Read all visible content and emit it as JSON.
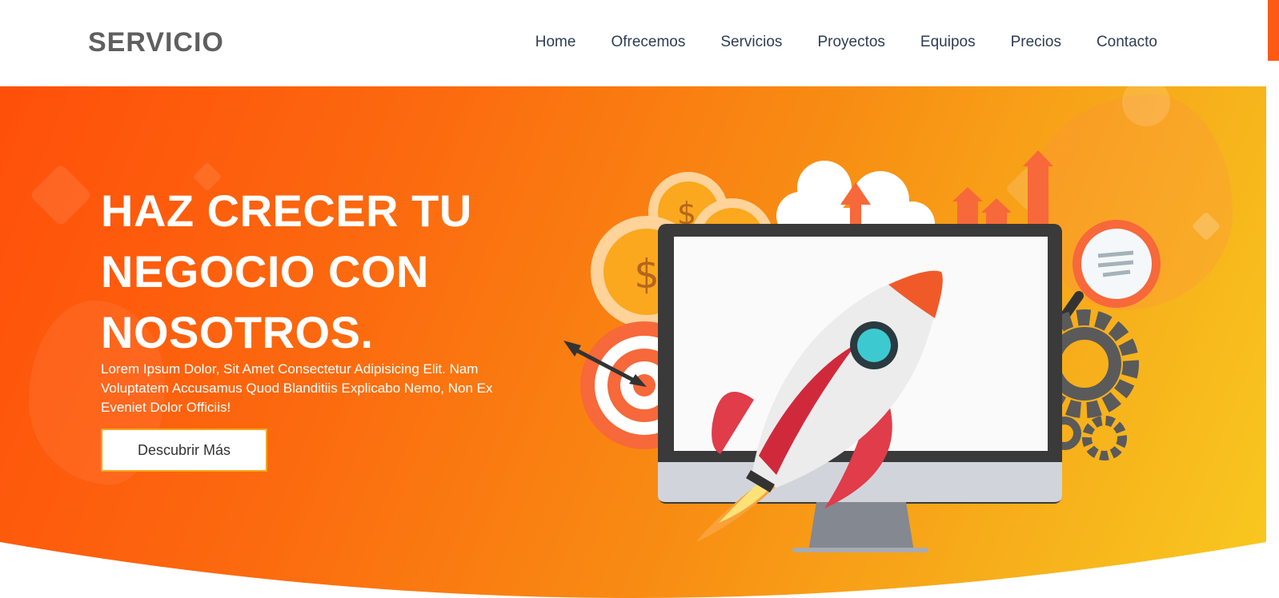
{
  "header": {
    "logo": "SERVICIO",
    "nav": [
      "Home",
      "Ofrecemos",
      "Servicios",
      "Proyectos",
      "Equipos",
      "Precios",
      "Contacto"
    ]
  },
  "hero": {
    "title_line1": "HAZ CRECER TU",
    "title_line2": "NEGOCIO CON",
    "title_line3": "NOSOTROS.",
    "description": "Lorem Ipsum Dolor, Sit Amet Consectetur Adipisicing Elit. Nam Voluptatem Accusamus Quod Blanditiis Explicabo Nemo, Non Ex Eveniet Dolor Officiis!",
    "cta_label": "Descubrir Más",
    "coin_symbol": "$"
  },
  "colors": {
    "accent": "#ff5a14",
    "gradient_start": "#ff4f0a",
    "gradient_end": "#f8c91f",
    "nav_text": "#2e3d55",
    "logo_text": "#5f5f5f"
  },
  "icons": [
    "rocket-icon",
    "monitor-icon",
    "cloud-upload-icon",
    "dollar-coin-icon",
    "target-icon",
    "gear-icon",
    "magnifier-icon",
    "growth-arrows-icon"
  ]
}
